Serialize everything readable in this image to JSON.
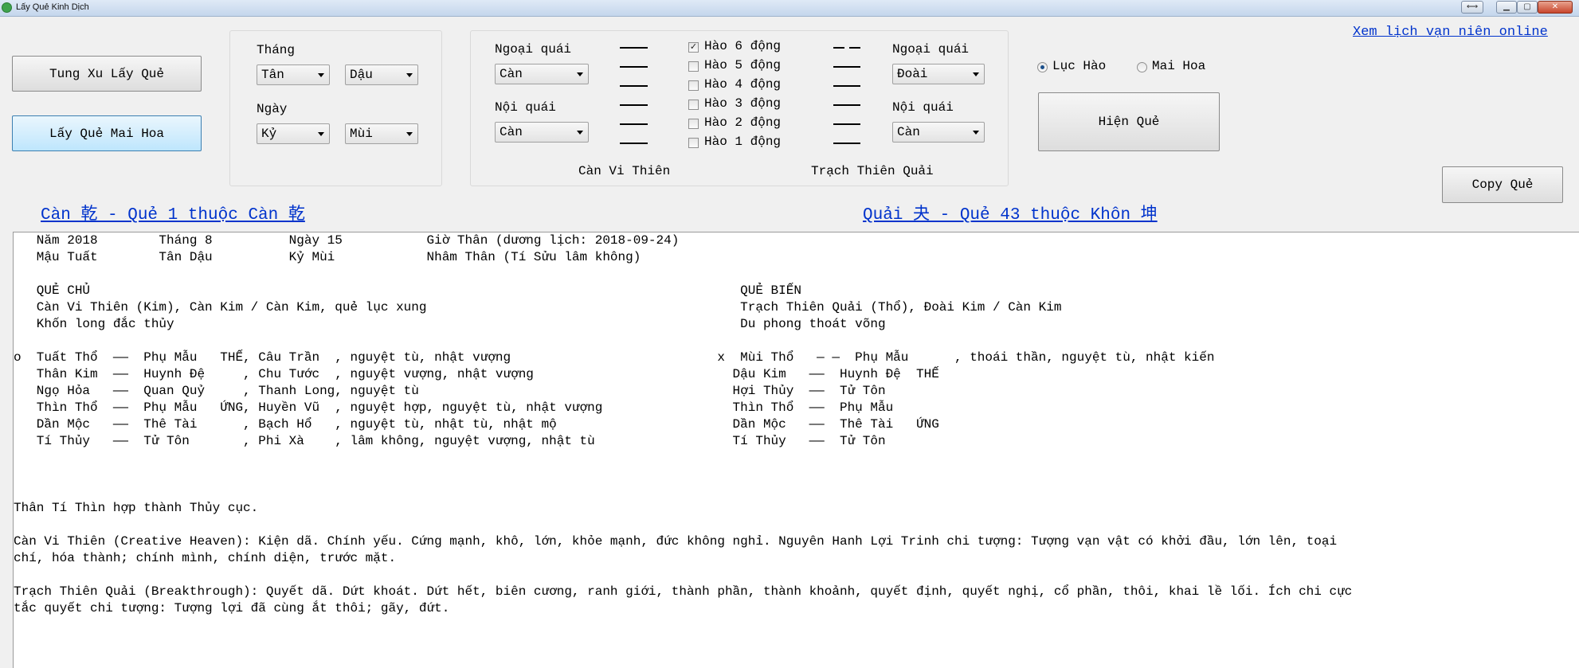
{
  "window": {
    "title": "Lấy Quẻ Kinh Dịch"
  },
  "buttons": {
    "tung_xu": "Tung Xu Lấy Quẻ",
    "lay_que_mai_hoa": "Lấy Quẻ Mai Hoa",
    "hien_que": "Hiện Quẻ",
    "copy_que": "Copy Quẻ"
  },
  "date_panel": {
    "thang_label": "Tháng",
    "thang_can": "Tân",
    "thang_chi": "Dậu",
    "ngay_label": "Ngày",
    "ngay_can": "Kỷ",
    "ngay_chi": "Mùi"
  },
  "que_panel": {
    "left_ngoai_label": "Ngoại quái",
    "left_ngoai_value": "Càn",
    "left_noi_label": "Nội quái",
    "left_noi_value": "Càn",
    "right_ngoai_label": "Ngoại quái",
    "right_ngoai_value": "Đoài",
    "right_noi_label": "Nội quái",
    "right_noi_value": "Càn",
    "hao": [
      {
        "label": "Hào 6 động",
        "checked": true
      },
      {
        "label": "Hào 5 động",
        "checked": false
      },
      {
        "label": "Hào 4 động",
        "checked": false
      },
      {
        "label": "Hào 3 động",
        "checked": false
      },
      {
        "label": "Hào 2 động",
        "checked": false
      },
      {
        "label": "Hào 1 động",
        "checked": false
      }
    ],
    "left_name": "Càn Vi Thiên",
    "right_name": "Trạch Thiên Quải"
  },
  "mode": {
    "luc_hao": "Lục Hào",
    "mai_hoa": "Mai Hoa",
    "selected": "luc_hao"
  },
  "links": {
    "lich_van_nien": "Xem lịch vạn niên online",
    "que_chu": "Càn 乾 - Quẻ 1 thuộc Càn 乾",
    "que_bien": "Quải 夬 - Quẻ 43 thuộc Khôn 坤"
  },
  "result": {
    "lines": [
      "   Năm 2018        Tháng 8          Ngày 15           Giờ Thân (dương lịch: 2018-09-24)",
      "   Mậu Tuất        Tân Dậu          Kỷ Mùi            Nhâm Thân (Tí Sửu lâm không)",
      "",
      "   QUẺ CHỦ                                                                                     QUẺ BIẾN",
      "   Càn Vi Thiên (Kim), Càn Kim / Càn Kim, quẻ lục xung                                         Trạch Thiên Quải (Thổ), Đoài Kim / Càn Kim",
      "   Khốn long đắc thủy                                                                          Du phong thoát võng",
      "",
      "o  Tuất Thổ  ——  Phụ Mẫu   THẾ, Câu Trần  , nguyệt tù, nhật vượng                           x  Mùi Thổ   — —  Phụ Mẫu      , thoái thần, nguyệt tù, nhật kiến",
      "   Thân Kim  ——  Huynh Đệ     , Chu Tước  , nguyệt vượng, nhật vượng                          Dậu Kim   ——  Huynh Đệ  THẾ",
      "   Ngọ Hỏa   ——  Quan Quỷ     , Thanh Long, nguyệt tù                                         Hợi Thủy  ——  Tử Tôn",
      "   Thìn Thổ  ——  Phụ Mẫu   ỨNG, Huyền Vũ  , nguyệt hợp, nguyệt tù, nhật vượng                 Thìn Thổ  ——  Phụ Mẫu",
      "   Dần Mộc   ——  Thê Tài      , Bạch Hổ   , nguyệt tù, nhật tù, nhật mộ                       Dần Mộc   ——  Thê Tài   ỨNG",
      "   Tí Thủy   ——  Tử Tôn       , Phi Xà    , lâm không, nguyệt vượng, nhật tù                  Tí Thủy   ——  Tử Tôn",
      "",
      "",
      "",
      "Thân Tí Thìn hợp thành Thủy cục.",
      "",
      "Càn Vi Thiên (Creative Heaven): Kiện dã. Chính yếu. Cứng mạnh, khô, lớn, khỏe mạnh, đức không nghỉ. Nguyên Hanh Lợi Trinh chi tượng: Tượng vạn vật có khởi đầu, lớn lên, toại",
      "chí, hóa thành; chính mình, chính diện, trước mặt.",
      "",
      "Trạch Thiên Quải (Breakthrough): Quyết dã. Dứt khoát. Dứt hết, biên cương, ranh giới, thành phần, thành khoảnh, quyết định, quyết nghị, cổ phần, thôi, khai lề lối. Ích chi cực",
      "tắc quyết chi tượng: Tượng lợi đã cùng ắt thôi; gãy, đứt."
    ]
  }
}
